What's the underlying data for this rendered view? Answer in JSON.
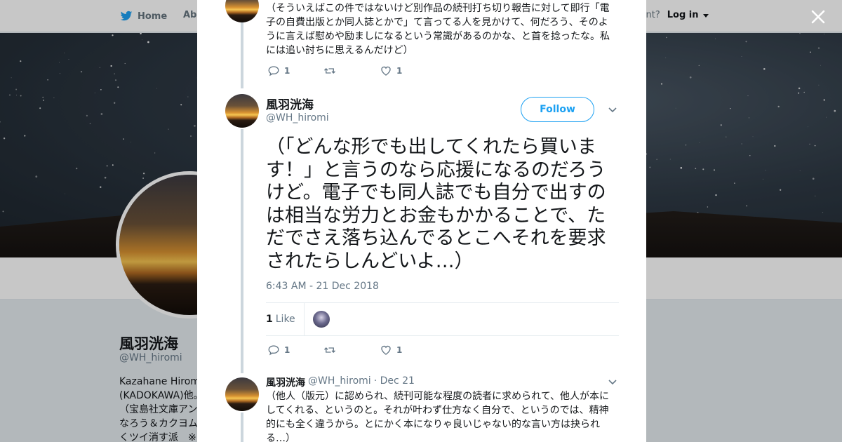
{
  "nav": {
    "home_label": "Home",
    "about_label": "Abo",
    "account_text": "ccount?",
    "login_label": "Log in"
  },
  "profile": {
    "name": "風羽洸海",
    "handle": "@WH_hiromi",
    "bio_lines": [
      "Kazahane Hiromi",
      "(KADOKAWA)他。",
      "（宝島社文庫アン",
      "なろう＆カクヨム",
      "くツイ消す派　※"
    ]
  },
  "prev_tweet": {
    "text": "（そういえばこの件ではないけど別作品の続刊打ち切り報告に対して即行「電子の自費出版とか同人誌とかで」て言ってる人を見かけて、何だろう、そのように言えば慰めや励ましになるという常識があるのかな、と首を捻ったな。私には追い討ちに思えるんだけど）",
    "replies": "1",
    "retweets": "",
    "likes": "1"
  },
  "main_tweet": {
    "name": "風羽洸海",
    "handle": "@WH_hiromi",
    "follow_label": "Follow",
    "text": "（「どんな形でも出してくれたら買います！」と言うのなら応援になるのだろうけど。電子でも同人誌でも自分で出すのは相当な労力とお金もかかることで、ただでさえ落ち込んでるとこへそれを要求されたらしんどいよ…）",
    "timestamp": "6:43 AM - 21 Dec 2018",
    "like_count": "1",
    "like_word": "Like",
    "replies": "1",
    "retweets": "",
    "likes": "1"
  },
  "next_tweet": {
    "name": "風羽洸海",
    "handle": "@WH_hiromi",
    "date": "· Dec 21",
    "text": "（他人（版元）に認められ、続刊可能な程度の読者に求められて、他人が本にしてくれる、というのと。それが叶わず仕方なく自分で、というのでは、精神的にも全く違うから。とにかく本になりゃ良いじゃない的な言い方は抉られる…）"
  },
  "colors": {
    "twitter_blue": "#1da1f2",
    "thread_line": "#ccd6dd",
    "secondary_text": "#657786"
  },
  "icons": [
    "twitter-bird-icon",
    "close-icon",
    "reply-icon",
    "retweet-icon",
    "like-heart-icon",
    "chevron-down-icon",
    "caret-down-icon"
  ]
}
